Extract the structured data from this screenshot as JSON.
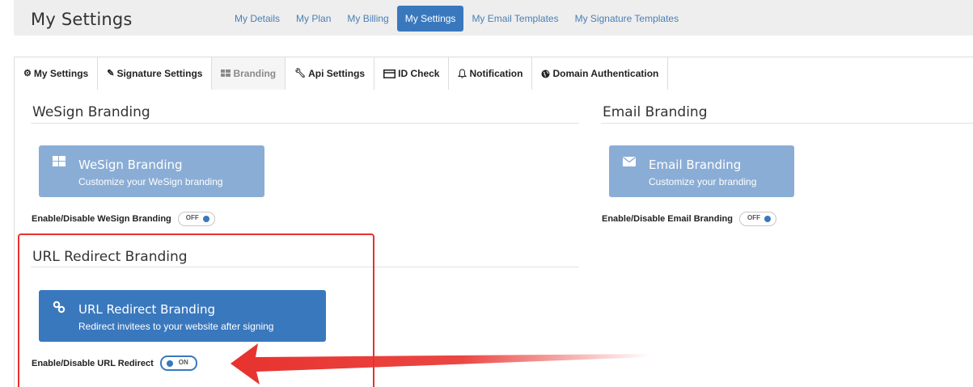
{
  "header": {
    "title": "My Settings",
    "nav": [
      {
        "label": "My Details",
        "active": false
      },
      {
        "label": "My Plan",
        "active": false
      },
      {
        "label": "My Billing",
        "active": false
      },
      {
        "label": "My Settings",
        "active": true
      },
      {
        "label": "My Email Templates",
        "active": false
      },
      {
        "label": "My Signature Templates",
        "active": false
      }
    ]
  },
  "tabs": [
    {
      "label": "My Settings",
      "icon": "gear-icon",
      "active": false
    },
    {
      "label": "Signature Settings",
      "icon": "pencil-icon",
      "active": false
    },
    {
      "label": "Branding",
      "icon": "grid-icon",
      "active": true
    },
    {
      "label": "Api Settings",
      "icon": "wrench-icon",
      "active": false
    },
    {
      "label": "ID Check",
      "icon": "id-card-icon",
      "active": false
    },
    {
      "label": "Notification",
      "icon": "bell-icon",
      "active": false
    },
    {
      "label": "Domain Authentication",
      "icon": "globe-icon",
      "active": false
    }
  ],
  "wesign": {
    "section_title": "WeSign Branding",
    "card_title": "WeSign Branding",
    "card_subtitle": "Customize your WeSign branding",
    "card_icon": "grid-icon",
    "toggle_label": "Enable/Disable WeSign Branding",
    "toggle_state": "OFF"
  },
  "email": {
    "section_title": "Email Branding",
    "card_title": "Email Branding",
    "card_subtitle": "Customize your branding",
    "card_icon": "envelope-icon",
    "toggle_label": "Enable/Disable Email Branding",
    "toggle_state": "OFF"
  },
  "redirect": {
    "section_title": "URL Redirect Branding",
    "card_title": "URL Redirect Branding",
    "card_subtitle": "Redirect invitees to your website after signing",
    "card_icon": "link-icon",
    "toggle_label": "Enable/Disable URL Redirect",
    "toggle_state": "ON"
  },
  "colors": {
    "primary": "#3a78be",
    "primary_light": "#8aadd6",
    "highlight": "#e8322e"
  }
}
